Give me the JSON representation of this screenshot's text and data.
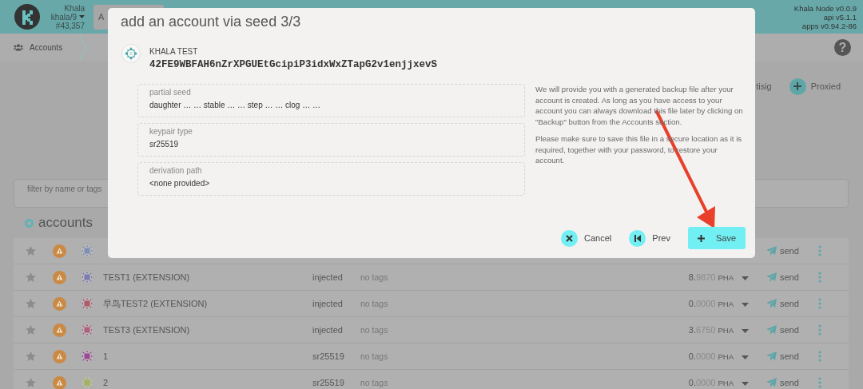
{
  "header": {
    "chain": {
      "name": "Khala",
      "account": "khala/9",
      "block": "#43,357"
    },
    "tab": {
      "label": "A"
    },
    "versions": [
      "Khala Node v0.0.9",
      "api v5.1.1",
      "apps v0.94.2-86"
    ]
  },
  "breadcrumb": {
    "label": "Accounts",
    "help": "?"
  },
  "actions": [
    {
      "label": "tisig",
      "kind": "text"
    },
    {
      "label": "Proxied",
      "kind": "add"
    }
  ],
  "filter": {
    "placeholder": "filter by name or tags"
  },
  "accounts_title": "accounts",
  "rows": [
    {
      "color": "#7f8fb4",
      "send": "send"
    },
    {
      "color": "#7c7cae",
      "name": "TEST1 (EXTENSION)",
      "type": "injected",
      "tags": "no tags",
      "balance": {
        "whole": "8.",
        "fraction": "9870",
        "unit": "PHA"
      },
      "send": "send"
    },
    {
      "color": "#b05a6c",
      "name": "早鸟TEST2 (EXTENSION)",
      "type": "injected",
      "tags": "no tags",
      "balance": {
        "whole": "0.",
        "fraction": "0000",
        "unit": "PHA"
      },
      "send": "send"
    },
    {
      "color": "#b0607e",
      "name": "TEST3 (EXTENSION)",
      "type": "injected",
      "tags": "no tags",
      "balance": {
        "whole": "3.",
        "fraction": "6750",
        "unit": "PHA"
      },
      "send": "send"
    },
    {
      "color": "#9c4a94",
      "name": "1",
      "type": "sr25519",
      "tags": "no tags",
      "balance": {
        "whole": "0.",
        "fraction": "0000",
        "unit": "PHA"
      },
      "send": "send"
    },
    {
      "color": "#a4b25c",
      "name": "2",
      "type": "sr25519",
      "tags": "no tags",
      "balance": {
        "whole": "0.",
        "fraction": "0000",
        "unit": "PHA"
      },
      "send": "send"
    }
  ],
  "modal": {
    "title": "add an account via seed 3/3",
    "account": {
      "name": "KHALA TEST",
      "address": "42FE9WBFAH6nZrXPGUEtGcipiP3idxWxZTapG2v1enjjxevS"
    },
    "fields": [
      {
        "label": "partial seed",
        "value": "daughter … … stable … … step … … clog … …"
      },
      {
        "label": "keypair type",
        "value": "sr25519"
      },
      {
        "label": "derivation path",
        "value": "<none provided>"
      }
    ],
    "help": [
      "We will provide you with a generated backup file after your account is created. As long as you have access to your account you can always download this file later by clicking on \"Backup\" button from the Accounts section.",
      "Please make sure to save this file in a secure location as it is required, together with your password, to restore your account."
    ],
    "buttons": [
      {
        "label": "Cancel",
        "kind": "secondary"
      },
      {
        "label": "Prev",
        "kind": "secondary"
      },
      {
        "label": "Save",
        "kind": "primary"
      }
    ]
  }
}
